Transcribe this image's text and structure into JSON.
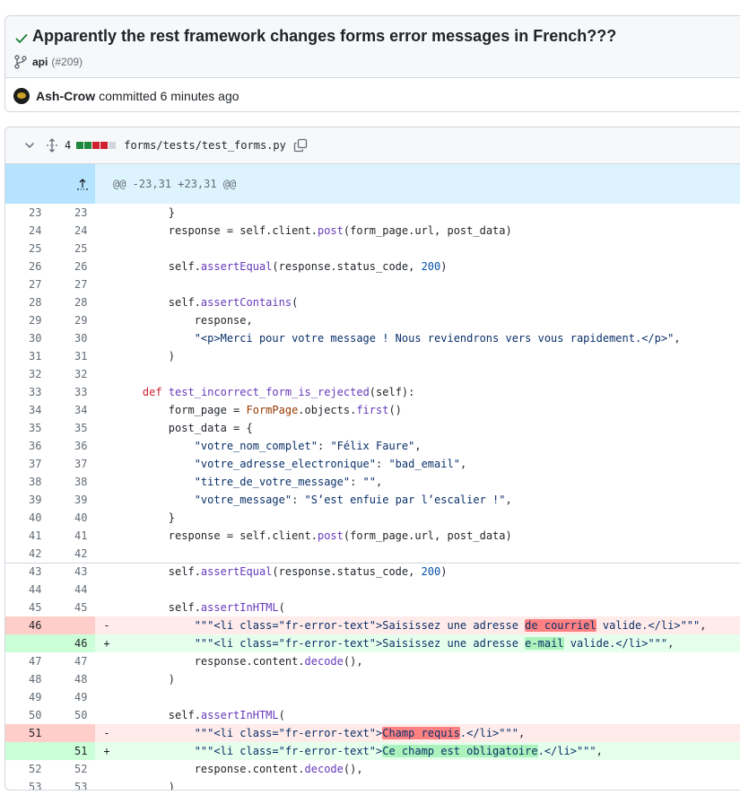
{
  "commit": {
    "title": "Apparently the rest framework changes forms error messages in French???",
    "branch": "api",
    "pr": "(#209)",
    "author": "Ash-Crow",
    "committed_text": "committed 6 minutes ago"
  },
  "file": {
    "changes": "4",
    "path": "forms/tests/test_forms.py",
    "diffstat_colors": [
      "#1f883d",
      "#1f883d",
      "#cf222e",
      "#cf222e",
      "#d0d7de"
    ],
    "hunk_header": "@@ -23,31 +23,31 @@"
  },
  "lines": [
    {
      "o": "23",
      "n": "23",
      "t": "ctx",
      "segs": [
        [
          "        }",
          ""
        ]
      ]
    },
    {
      "o": "24",
      "n": "24",
      "t": "ctx",
      "segs": [
        [
          "        response = self.client.",
          ""
        ],
        [
          "post",
          "fn"
        ],
        [
          "(form_page.url, post_data)",
          ""
        ]
      ]
    },
    {
      "o": "25",
      "n": "25",
      "t": "ctx",
      "segs": [
        [
          "",
          ""
        ]
      ]
    },
    {
      "o": "26",
      "n": "26",
      "t": "ctx",
      "segs": [
        [
          "        self.",
          ""
        ],
        [
          "assertEqual",
          "fn"
        ],
        [
          "(response.status_code, ",
          ""
        ],
        [
          "200",
          "nm"
        ],
        [
          ")",
          ""
        ]
      ]
    },
    {
      "o": "27",
      "n": "27",
      "t": "ctx",
      "segs": [
        [
          "",
          ""
        ]
      ]
    },
    {
      "o": "28",
      "n": "28",
      "t": "ctx",
      "segs": [
        [
          "        self.",
          ""
        ],
        [
          "assertContains",
          "fn"
        ],
        [
          "(",
          ""
        ]
      ]
    },
    {
      "o": "29",
      "n": "29",
      "t": "ctx",
      "segs": [
        [
          "            response,",
          ""
        ]
      ]
    },
    {
      "o": "30",
      "n": "30",
      "t": "ctx",
      "segs": [
        [
          "            ",
          ""
        ],
        [
          "\"<p>Merci pour votre message ! Nous reviendrons vers vous rapidement.</p>\"",
          "st"
        ],
        [
          ",",
          ""
        ]
      ]
    },
    {
      "o": "31",
      "n": "31",
      "t": "ctx",
      "segs": [
        [
          "        )",
          ""
        ]
      ]
    },
    {
      "o": "32",
      "n": "32",
      "t": "ctx",
      "segs": [
        [
          "",
          ""
        ]
      ]
    },
    {
      "o": "33",
      "n": "33",
      "t": "ctx",
      "segs": [
        [
          "    ",
          ""
        ],
        [
          "def",
          "kw"
        ],
        [
          " ",
          ""
        ],
        [
          "test_incorrect_form_is_rejected",
          "fn"
        ],
        [
          "(self):",
          ""
        ]
      ]
    },
    {
      "o": "34",
      "n": "34",
      "t": "ctx",
      "segs": [
        [
          "        form_page = ",
          ""
        ],
        [
          "FormPage",
          "cls"
        ],
        [
          ".objects.",
          ""
        ],
        [
          "first",
          "fn"
        ],
        [
          "()",
          ""
        ]
      ]
    },
    {
      "o": "35",
      "n": "35",
      "t": "ctx",
      "segs": [
        [
          "        post_data = {",
          ""
        ]
      ]
    },
    {
      "o": "36",
      "n": "36",
      "t": "ctx",
      "segs": [
        [
          "            ",
          ""
        ],
        [
          "\"votre_nom_complet\"",
          "st"
        ],
        [
          ": ",
          ""
        ],
        [
          "\"Félix Faure\"",
          "st"
        ],
        [
          ",",
          ""
        ]
      ]
    },
    {
      "o": "37",
      "n": "37",
      "t": "ctx",
      "segs": [
        [
          "            ",
          ""
        ],
        [
          "\"votre_adresse_electronique\"",
          "st"
        ],
        [
          ": ",
          ""
        ],
        [
          "\"bad_email\"",
          "st"
        ],
        [
          ",",
          ""
        ]
      ]
    },
    {
      "o": "38",
      "n": "38",
      "t": "ctx",
      "segs": [
        [
          "            ",
          ""
        ],
        [
          "\"titre_de_votre_message\"",
          "st"
        ],
        [
          ": ",
          ""
        ],
        [
          "\"\"",
          "st"
        ],
        [
          ",",
          ""
        ]
      ]
    },
    {
      "o": "39",
      "n": "39",
      "t": "ctx",
      "segs": [
        [
          "            ",
          ""
        ],
        [
          "\"votre_message\"",
          "st"
        ],
        [
          ": ",
          ""
        ],
        [
          "\"S’est enfuie par l’escalier !\"",
          "st"
        ],
        [
          ",",
          ""
        ]
      ]
    },
    {
      "o": "40",
      "n": "40",
      "t": "ctx",
      "segs": [
        [
          "        }",
          ""
        ]
      ]
    },
    {
      "o": "41",
      "n": "41",
      "t": "ctx",
      "segs": [
        [
          "        response = self.client.",
          ""
        ],
        [
          "post",
          "fn"
        ],
        [
          "(form_page.url, post_data)",
          ""
        ]
      ]
    },
    {
      "o": "42",
      "n": "42",
      "t": "ctx",
      "segs": [
        [
          "",
          ""
        ]
      ]
    },
    {
      "o": "43",
      "n": "43",
      "t": "ctx",
      "sep": true,
      "segs": [
        [
          "        self.",
          ""
        ],
        [
          "assertEqual",
          "fn"
        ],
        [
          "(response.status_code, ",
          ""
        ],
        [
          "200",
          "nm"
        ],
        [
          ")",
          ""
        ]
      ]
    },
    {
      "o": "44",
      "n": "44",
      "t": "ctx",
      "segs": [
        [
          "",
          ""
        ]
      ]
    },
    {
      "o": "45",
      "n": "45",
      "t": "ctx",
      "segs": [
        [
          "        self.",
          ""
        ],
        [
          "assertInHTML",
          "fn"
        ],
        [
          "(",
          ""
        ]
      ]
    },
    {
      "o": "46",
      "n": "",
      "t": "del",
      "segs": [
        [
          "            ",
          ""
        ],
        [
          "\"\"\"<li class=\"fr-error-text\">Saisissez une adresse ",
          "st"
        ],
        [
          "de courriel",
          "st xdel-strong"
        ],
        [
          " valide.</li>\"\"\"",
          "st"
        ],
        [
          ",",
          ""
        ]
      ]
    },
    {
      "o": "",
      "n": "46",
      "t": "add",
      "segs": [
        [
          "            ",
          ""
        ],
        [
          "\"\"\"<li class=\"fr-error-text\">Saisissez une adresse ",
          "st"
        ],
        [
          "e-mail",
          "st xadd"
        ],
        [
          " valide.</li>\"\"\"",
          "st"
        ],
        [
          ",",
          ""
        ]
      ]
    },
    {
      "o": "47",
      "n": "47",
      "t": "ctx",
      "segs": [
        [
          "            response.content.",
          ""
        ],
        [
          "decode",
          "fn"
        ],
        [
          "(),",
          ""
        ]
      ]
    },
    {
      "o": "48",
      "n": "48",
      "t": "ctx",
      "segs": [
        [
          "        )",
          ""
        ]
      ]
    },
    {
      "o": "49",
      "n": "49",
      "t": "ctx",
      "segs": [
        [
          "",
          ""
        ]
      ]
    },
    {
      "o": "50",
      "n": "50",
      "t": "ctx",
      "segs": [
        [
          "        self.",
          ""
        ],
        [
          "assertInHTML",
          "fn"
        ],
        [
          "(",
          ""
        ]
      ]
    },
    {
      "o": "51",
      "n": "",
      "t": "del",
      "segs": [
        [
          "            ",
          ""
        ],
        [
          "\"\"\"<li class=\"fr-error-text\">",
          "st"
        ],
        [
          "Champ requis",
          "st xdel-strong"
        ],
        [
          ".</li>\"\"\"",
          "st"
        ],
        [
          ",",
          ""
        ]
      ]
    },
    {
      "o": "",
      "n": "51",
      "t": "add",
      "segs": [
        [
          "            ",
          ""
        ],
        [
          "\"\"\"<li class=\"fr-error-text\">",
          "st"
        ],
        [
          "Ce champ est obligatoire",
          "st xadd"
        ],
        [
          ".</li>\"\"\"",
          "st"
        ],
        [
          ",",
          ""
        ]
      ]
    },
    {
      "o": "52",
      "n": "52",
      "t": "ctx",
      "segs": [
        [
          "            response.content.",
          ""
        ],
        [
          "decode",
          "fn"
        ],
        [
          "(),",
          ""
        ]
      ]
    },
    {
      "o": "53",
      "n": "53",
      "t": "ctx",
      "segs": [
        [
          "        )",
          ""
        ]
      ]
    }
  ]
}
